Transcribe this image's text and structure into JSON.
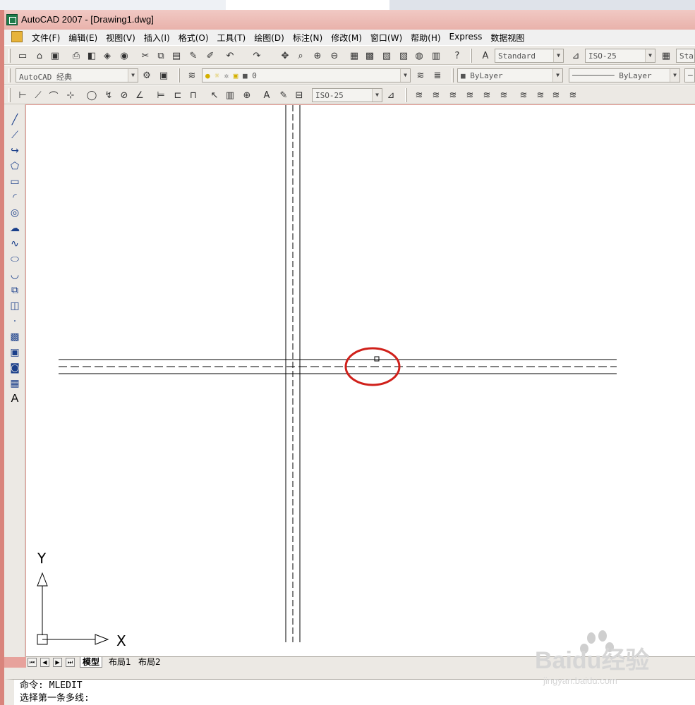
{
  "window": {
    "title": "AutoCAD 2007 - [Drawing1.dwg]"
  },
  "menubar": {
    "items": [
      "文件(F)",
      "编辑(E)",
      "视图(V)",
      "插入(I)",
      "格式(O)",
      "工具(T)",
      "绘图(D)",
      "标注(N)",
      "修改(M)",
      "窗口(W)",
      "帮助(H)",
      "Express",
      "数据视图"
    ]
  },
  "toolbar1": {
    "text_style": "Standard",
    "dim_style": "ISO-25",
    "table_style": "Stan"
  },
  "toolbar2": {
    "workspace": "AutoCAD 经典",
    "layer": "0",
    "color": "ByLayer",
    "linetype": "ByLayer"
  },
  "toolbar3": {
    "dim_style": "ISO-25"
  },
  "ucs": {
    "x_label": "X",
    "y_label": "Y"
  },
  "layout_tabs": [
    "模型",
    "布局1",
    "布局2"
  ],
  "command": {
    "line1": "命令: MLEDIT",
    "line2": "选择第一条多线:"
  },
  "watermark": {
    "brand": "Baidu经验",
    "url": "jingyan.baidu.com"
  },
  "colors": {
    "highlight_circle": "#d0201a",
    "title_bar": "#eab5ae"
  }
}
